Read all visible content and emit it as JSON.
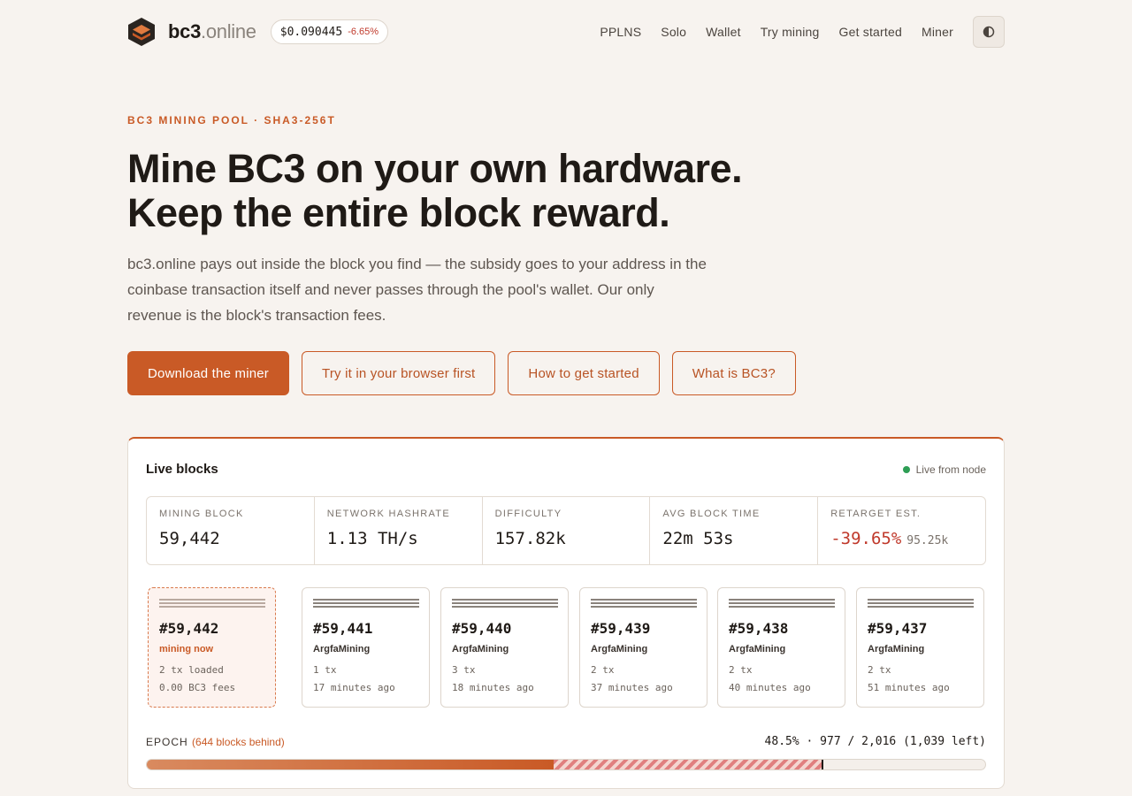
{
  "header": {
    "brand_main": "bc3",
    "brand_suffix": ".online",
    "price": "$0.090445",
    "price_change": "-6.65%",
    "nav": [
      "PPLNS",
      "Solo",
      "Wallet",
      "Try mining",
      "Get started",
      "Miner"
    ],
    "theme_icon": "contrast-icon"
  },
  "hero": {
    "eyebrow": "BC3 MINING POOL · SHA3-256T",
    "headline_line1": "Mine BC3 on your own hardware.",
    "headline_line2": "Keep the entire block reward.",
    "lede": "bc3.online pays out inside the block you find — the subsidy goes to your address in the coinbase transaction itself and never passes through the pool's wallet. Our only revenue is the block's transaction fees.",
    "cta_primary": "Download the miner",
    "cta_browser": "Try it in your browser first",
    "cta_started": "How to get started",
    "cta_what": "What is BC3?"
  },
  "live": {
    "title": "Live blocks",
    "status": "Live from node",
    "status_color": "#2e9e55",
    "stats": [
      {
        "label": "MINING BLOCK",
        "value": "59,442"
      },
      {
        "label": "NETWORK HASHRATE",
        "value": "1.13 TH/s"
      },
      {
        "label": "DIFFICULTY",
        "value": "157.82k"
      },
      {
        "label": "AVG BLOCK TIME",
        "value": "22m 53s"
      },
      {
        "label": "RETARGET EST.",
        "value": "-39.65%",
        "sub": "95.25k"
      }
    ],
    "current_block": {
      "number": "#59,442",
      "status": "mining now",
      "tx": "2 tx loaded",
      "fees": "0.00 BC3 fees"
    },
    "blocks": [
      {
        "number": "#59,441",
        "miner": "ArgfaMining",
        "tx": "1 tx",
        "age": "17 minutes ago"
      },
      {
        "number": "#59,440",
        "miner": "ArgfaMining",
        "tx": "3 tx",
        "age": "18 minutes ago"
      },
      {
        "number": "#59,439",
        "miner": "ArgfaMining",
        "tx": "2 tx",
        "age": "37 minutes ago"
      },
      {
        "number": "#59,438",
        "miner": "ArgfaMining",
        "tx": "2 tx",
        "age": "40 minutes ago"
      },
      {
        "number": "#59,437",
        "miner": "ArgfaMining",
        "tx": "2 tx",
        "age": "51 minutes ago"
      }
    ],
    "epoch": {
      "label": "EPOCH",
      "behind": "(644 blocks behind)",
      "summary": "48.5% · 977 / 2,016 (1,039 left)",
      "progress_fraction": 0.485,
      "behind_start_fraction": 0.485,
      "behind_end_fraction": 0.805
    }
  },
  "colors": {
    "accent": "#c95a26",
    "negative": "#c0392b",
    "background": "#f7f3ef"
  }
}
